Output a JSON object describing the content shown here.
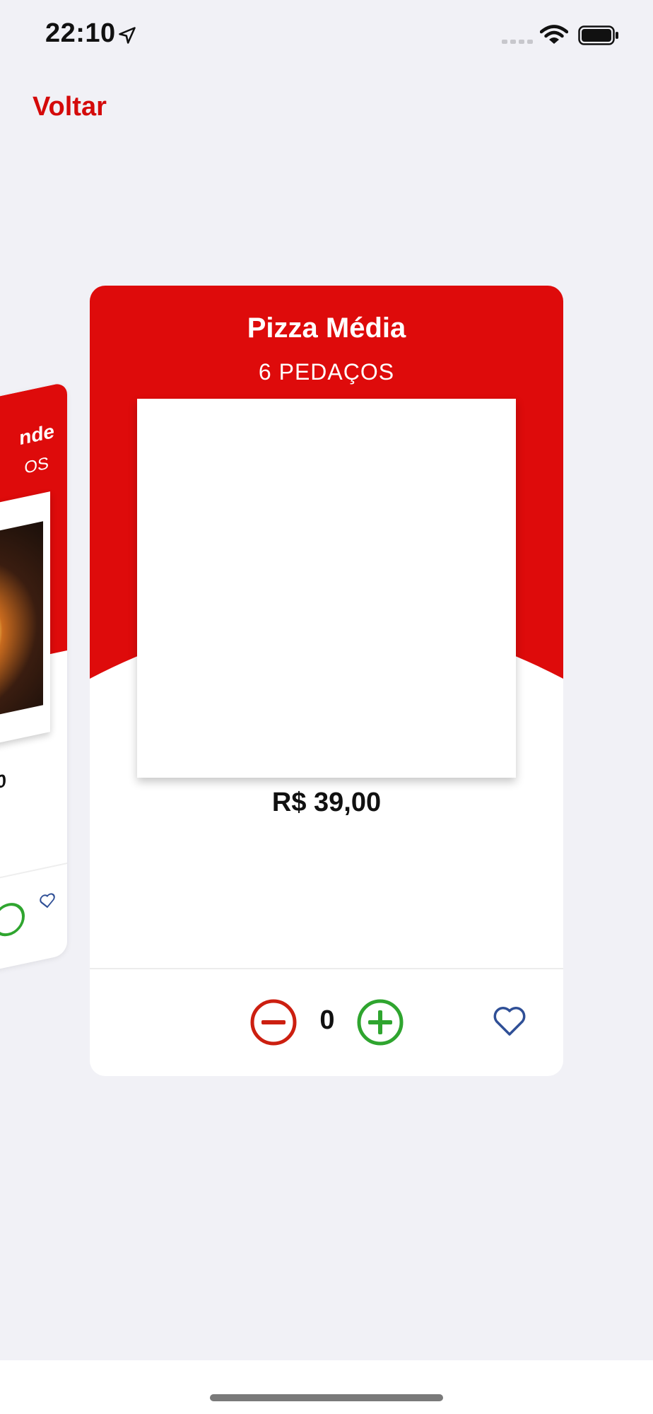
{
  "status_bar": {
    "time": "22:10"
  },
  "nav": {
    "back_label": "Voltar"
  },
  "side_card": {
    "title_partial": "nde",
    "subtitle_partial": "OS",
    "price_partial": "0"
  },
  "product": {
    "name": "Pizza Média",
    "subtitle": "6 PEDAÇOS",
    "price": "R$ 39,00",
    "quantity": "0"
  },
  "icons": {
    "location": "location-arrow-icon",
    "wifi": "wifi-icon",
    "battery": "battery-icon",
    "minus": "minus-circle-icon",
    "plus": "plus-circle-icon",
    "favorite": "heart-icon"
  },
  "colors": {
    "accent_red": "#de0b0b",
    "back_red": "#d40a0a",
    "minus_red": "#cc1f10",
    "plus_green": "#2fa52f",
    "heart_blue": "#2f4f96",
    "background": "#f1f1f6"
  }
}
